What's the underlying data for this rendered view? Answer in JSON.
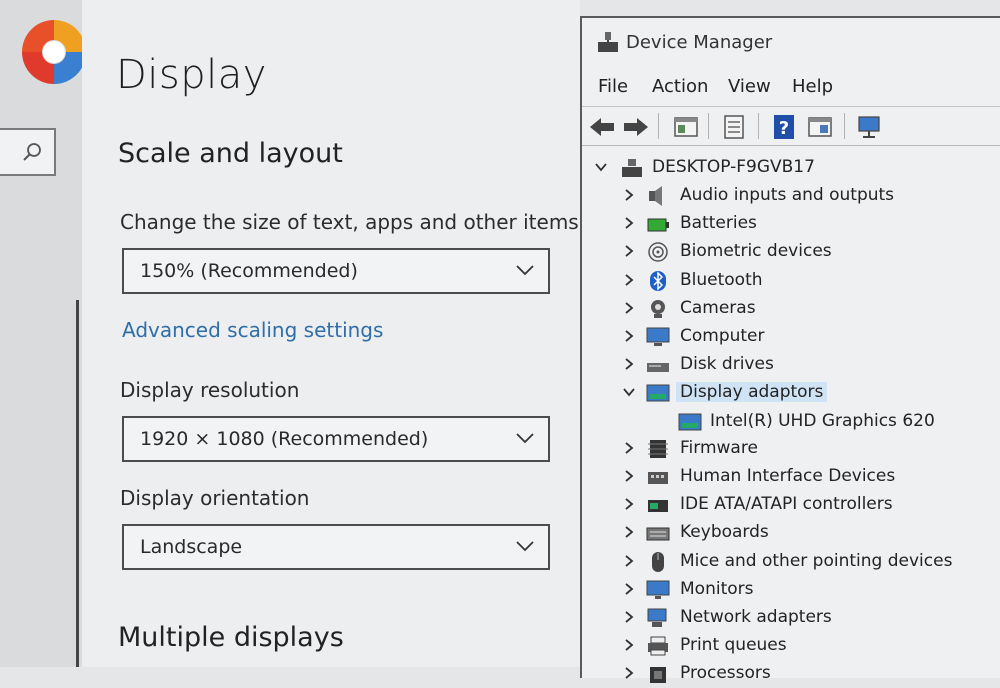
{
  "sidebar": {
    "search_placeholder": ""
  },
  "settings": {
    "page_title": "Display",
    "scale_section_title": "Scale and layout",
    "scale_label": "Change the size of text, apps and other items",
    "scale_value": "150% (Recommended)",
    "advanced_link": "Advanced scaling settings",
    "resolution_label": "Display resolution",
    "resolution_value": "1920 × 1080 (Recommended)",
    "orientation_label": "Display orientation",
    "orientation_value": "Landscape",
    "multiple_section_title": "Multiple displays"
  },
  "device_manager": {
    "title": "Device Manager",
    "menu": [
      "File",
      "Action",
      "View",
      "Help"
    ],
    "toolbar_icons": [
      "back-arrow-icon",
      "forward-arrow-icon",
      "properties-icon",
      "list-icon",
      "help-icon",
      "update-driver-icon",
      "monitor-icon"
    ],
    "root": "DESKTOP-F9GVB17",
    "categories": [
      {
        "label": "Audio inputs and outputs",
        "icon": "speaker-icon"
      },
      {
        "label": "Batteries",
        "icon": "battery-icon"
      },
      {
        "label": "Biometric devices",
        "icon": "fingerprint-icon"
      },
      {
        "label": "Bluetooth",
        "icon": "bluetooth-icon"
      },
      {
        "label": "Cameras",
        "icon": "camera-icon"
      },
      {
        "label": "Computer",
        "icon": "computer-icon"
      },
      {
        "label": "Disk drives",
        "icon": "disk-drive-icon"
      },
      {
        "label": "Display adaptors",
        "icon": "display-adapter-icon",
        "expanded": true,
        "selected": true
      },
      {
        "label": "Firmware",
        "icon": "chip-icon"
      },
      {
        "label": "Human Interface Devices",
        "icon": "hid-icon"
      },
      {
        "label": "IDE ATA/ATAPI controllers",
        "icon": "controller-icon"
      },
      {
        "label": "Keyboards",
        "icon": "keyboard-icon"
      },
      {
        "label": "Mice and other pointing devices",
        "icon": "mouse-icon"
      },
      {
        "label": "Monitors",
        "icon": "monitor-icon"
      },
      {
        "label": "Network adapters",
        "icon": "network-icon"
      },
      {
        "label": "Print queues",
        "icon": "printer-icon"
      },
      {
        "label": "Processors",
        "icon": "processor-icon"
      }
    ],
    "display_child": "Intel(R) UHD Graphics 620",
    "colors": {
      "selection": "#cfe3f5",
      "link": "#2f6ea8"
    }
  }
}
